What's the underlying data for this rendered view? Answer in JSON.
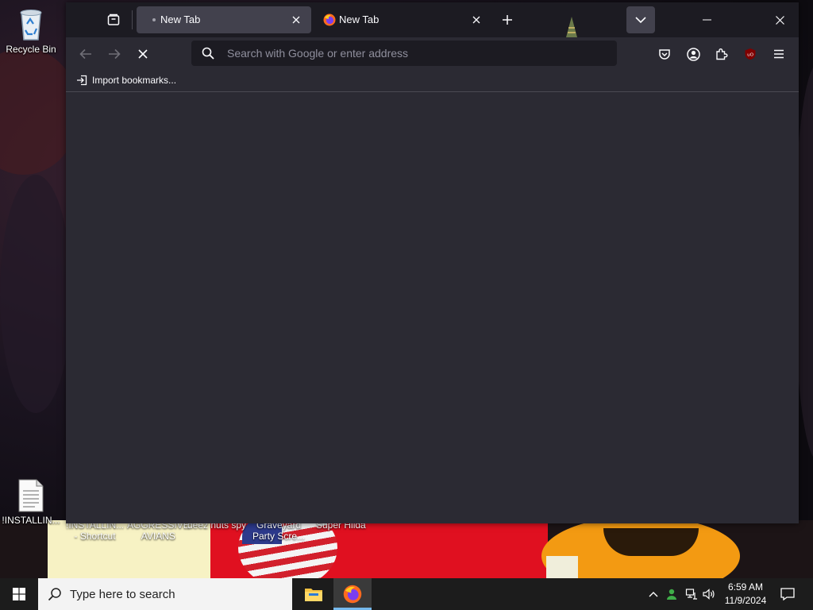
{
  "desktop": {
    "recycle_bin_label": "Recycle Bin",
    "icons": [
      {
        "label": "!INSTALLIN..."
      },
      {
        "label_line1": "!INSTALLIN...",
        "label_line2": "- Shortcut"
      },
      {
        "label_line1": "AGGRESSIVE",
        "label_line2": "AVIANS"
      },
      {
        "label": "deez nuts spy"
      },
      {
        "label_line1": "Graveyard",
        "label_line2": "Party Scre..."
      },
      {
        "label": "Super Hilda"
      }
    ]
  },
  "browser": {
    "tabs": [
      {
        "title": "New Tab",
        "state": "loading",
        "active": true
      },
      {
        "title": "New Tab",
        "icon": "firefox-icon",
        "active": false
      }
    ],
    "urlbar": {
      "placeholder": "Search with Google or enter address"
    },
    "bookmarks_toolbar": {
      "import_label": "Import bookmarks..."
    },
    "colors": {
      "frame": "#1c1b22",
      "toolbar": "#2b2a33",
      "active_tab": "#42414d",
      "ublock": "#800000"
    }
  },
  "taskbar": {
    "search_placeholder": "Type here to search",
    "apps": [
      "file-explorer-icon",
      "firefox-icon"
    ],
    "clock": {
      "time": "6:59 AM",
      "date": "11/9/2024"
    }
  }
}
